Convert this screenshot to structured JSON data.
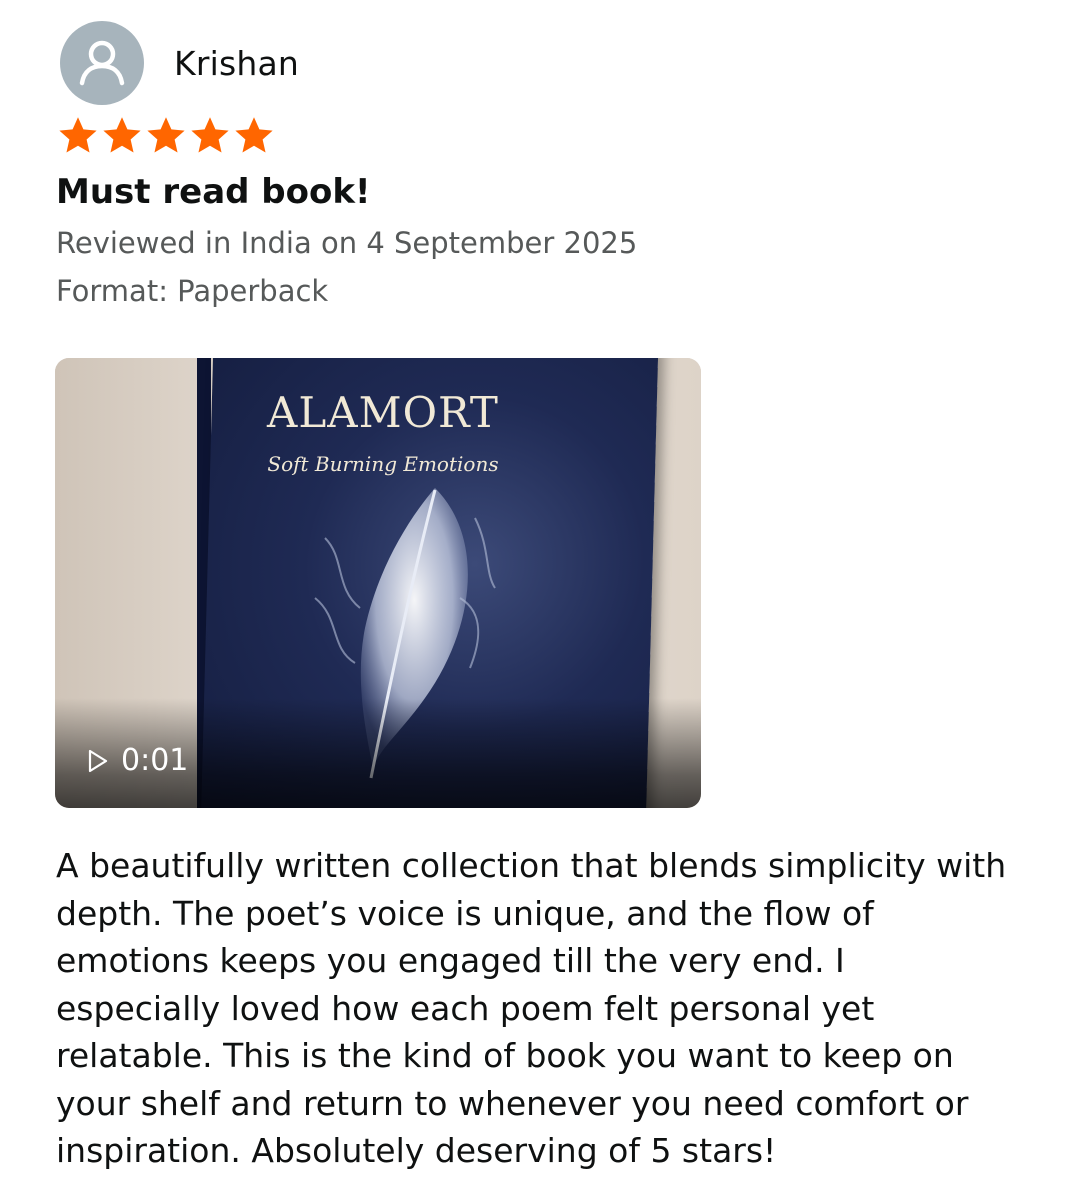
{
  "reviewer": {
    "name": "Krishan",
    "avatar_icon": "user-avatar-icon"
  },
  "rating": {
    "stars": 5,
    "out_of": 5,
    "star_color": "#ff6600"
  },
  "review": {
    "title": "Must read book!",
    "date_line": "Reviewed in India on 4 September 2025",
    "format_line": "Format: Paperback",
    "body": "A beautifully written collection that blends simplicity with depth. The poet’s voice is unique, and the flow of emotions keeps you engaged till the very end. I especially loved how each poem felt personal yet relatable. This is the kind of book you want to keep on your shelf and return to whenever you need comfort or inspiration. Absolutely deserving of 5 stars!"
  },
  "video": {
    "duration": "0:01",
    "play_icon": "play-icon",
    "book_title": "ALAMORT",
    "book_subtitle": "Soft Burning Emotions"
  }
}
